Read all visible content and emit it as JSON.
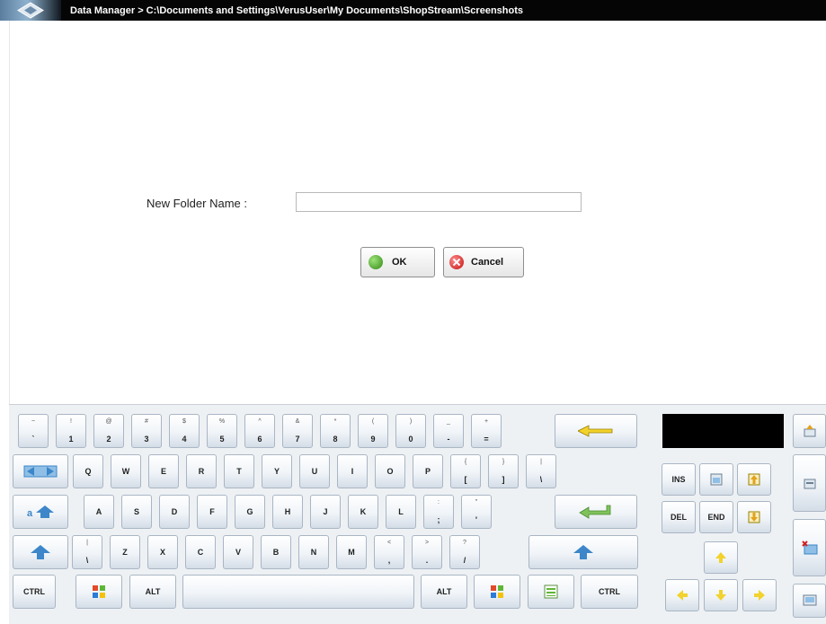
{
  "window": {
    "logo_icon": "diamond-logo-icon",
    "title": "Data Manager   > C:\\Documents and Settings\\VerusUser\\My Documents\\ShopStream\\Screenshots"
  },
  "dialog": {
    "label": "New Folder Name :",
    "input_value": "",
    "input_placeholder": "",
    "ok_label": "OK",
    "cancel_label": "Cancel"
  },
  "keyboard": {
    "row1": [
      {
        "top": "~",
        "bot": "`"
      },
      {
        "top": "!",
        "bot": "1"
      },
      {
        "top": "@",
        "bot": "2"
      },
      {
        "top": "#",
        "bot": "3"
      },
      {
        "top": "$",
        "bot": "4"
      },
      {
        "top": "%",
        "bot": "5"
      },
      {
        "top": "^",
        "bot": "6"
      },
      {
        "top": "&",
        "bot": "7"
      },
      {
        "top": "*",
        "bot": "8"
      },
      {
        "top": "(",
        "bot": "9"
      },
      {
        "top": ")",
        "bot": "0"
      },
      {
        "top": "_",
        "bot": "-"
      },
      {
        "top": "+",
        "bot": "="
      }
    ],
    "row2": [
      {
        "label": "Q"
      },
      {
        "label": "W"
      },
      {
        "label": "E"
      },
      {
        "label": "R"
      },
      {
        "label": "T"
      },
      {
        "label": "Y"
      },
      {
        "label": "U"
      },
      {
        "label": "I"
      },
      {
        "label": "O"
      },
      {
        "label": "P"
      },
      {
        "top": "{",
        "bot": "["
      },
      {
        "top": "}",
        "bot": "]"
      },
      {
        "top": "|",
        "bot": "\\"
      }
    ],
    "row3": [
      {
        "label": "A"
      },
      {
        "label": "S"
      },
      {
        "label": "D"
      },
      {
        "label": "F"
      },
      {
        "label": "G"
      },
      {
        "label": "H"
      },
      {
        "label": "J"
      },
      {
        "label": "K"
      },
      {
        "label": "L"
      },
      {
        "top": ":",
        "bot": ";"
      },
      {
        "top": "\"",
        "bot": "'"
      }
    ],
    "row4": [
      {
        "top": "|",
        "bot": "\\"
      },
      {
        "label": "Z"
      },
      {
        "label": "X"
      },
      {
        "label": "C"
      },
      {
        "label": "V"
      },
      {
        "label": "B"
      },
      {
        "label": "N"
      },
      {
        "label": "M"
      },
      {
        "top": "<",
        "bot": ","
      },
      {
        "top": ">",
        "bot": "."
      },
      {
        "top": "?",
        "bot": "/"
      }
    ],
    "ctrl_label": "CTRL",
    "alt_label": "ALT",
    "ins_label": "INS",
    "del_label": "DEL",
    "end_label": "END",
    "icons": {
      "backspace": "backspace-arrow-icon",
      "tab": "tab-icon",
      "caps": "caps-lock-icon",
      "enter": "enter-icon",
      "shift": "shift-arrow-icon",
      "windows": "windows-logo-icon",
      "menu": "context-menu-icon",
      "home": "home-icon",
      "page_up": "page-up-icon",
      "page_down": "page-down-icon",
      "arrows": "arrow-keys-icon",
      "side": [
        "keyboard-up-icon",
        "keyboard-layout-icon",
        "close-keyboard-icon",
        "screenshot-icon"
      ]
    }
  },
  "colors": {
    "titlebar_bg": "#050505",
    "key_border": "#a9b6c4",
    "arrow_blue": "#3c86c9",
    "arrow_yellow": "#f2d22c",
    "ok_green": "#2f8a12",
    "cancel_red": "#c41010"
  }
}
